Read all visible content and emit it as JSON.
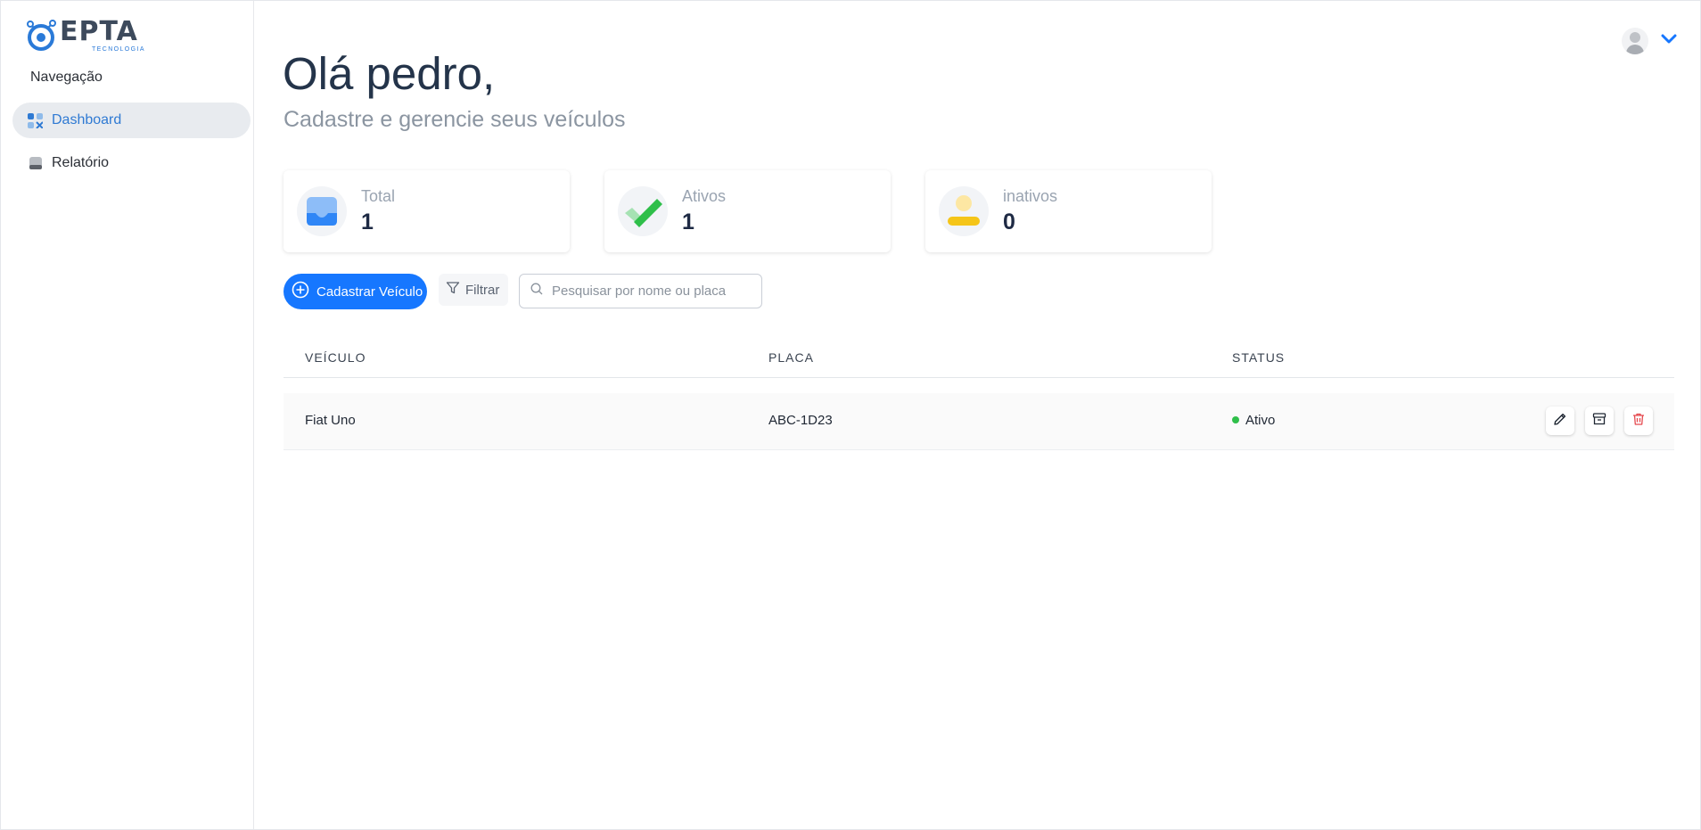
{
  "brand": {
    "name": "EPTA",
    "tagline": "TECNOLOGIA"
  },
  "sidebar": {
    "heading": "Navegação",
    "items": [
      {
        "label": "Dashboard",
        "icon": "dashboard-grid-icon",
        "active": true
      },
      {
        "label": "Relatório",
        "icon": "report-tray-icon",
        "active": false
      }
    ]
  },
  "header": {
    "greeting": "Olá pedro,",
    "subtitle": "Cadastre e gerencie seus veículos"
  },
  "stats": [
    {
      "label": "Total",
      "value": "1",
      "icon": "inbox-tray-icon",
      "color": "#2f86f6"
    },
    {
      "label": "Ativos",
      "value": "1",
      "icon": "checkmark-icon",
      "color": "#2fbf4a"
    },
    {
      "label": "inativos",
      "value": "0",
      "icon": "user-inactive-icon",
      "color": "#f5c518"
    }
  ],
  "toolbar": {
    "add_label": "Cadastrar Veículo",
    "filter_label": "Filtrar",
    "search_placeholder": "Pesquisar por nome ou placa"
  },
  "table": {
    "columns": [
      "VEÍCULO",
      "PLACA",
      "STATUS"
    ],
    "rows": [
      {
        "vehicle": "Fiat Uno",
        "plate": "ABC-1D23",
        "status": "Ativo",
        "status_color": "#2fbf4a"
      }
    ]
  },
  "colors": {
    "accent": "#1677ff",
    "danger": "#e5484d"
  }
}
